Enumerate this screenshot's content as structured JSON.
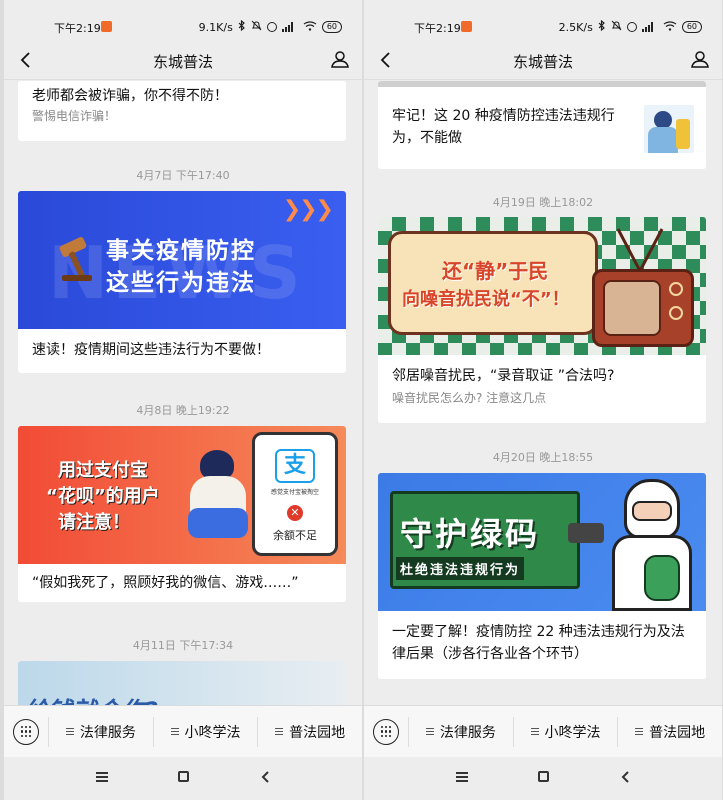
{
  "left": {
    "status": {
      "time": "下午2:19",
      "speed": "9.1K/s",
      "battery": "60"
    },
    "nav": {
      "title": "东城普法"
    },
    "card0": {
      "title": "老师都会被诈骗，你不得不防！",
      "sub": "警惕电信诈骗！"
    },
    "ts1": "4月7日 下午17:40",
    "card1": {
      "banner_line1": "事关疫情防控",
      "banner_line2": "这些行为违法",
      "banner_bg_word": "NEWS",
      "title": "速读！疫情期间这些违法行为不要做！"
    },
    "ts2": "4月8日 晚上19:22",
    "card2": {
      "banner_line1": "用过支付宝",
      "banner_line2": "“花呗”的用户",
      "banner_line3": "请注意！",
      "phone_logo": "支",
      "phone_small": "感觉支付宝被掏空",
      "phone_balance": "余额不足",
      "title": "“假如我死了，照顾好我的微信、游戏……”"
    },
    "ts3": "4月11日 下午17:34",
    "card3": {
      "banner_line1": "给钱就合作?"
    },
    "menu": [
      "法律服务",
      "小咚学法",
      "普法园地"
    ]
  },
  "right": {
    "status": {
      "time": "下午2:19",
      "speed": "2.5K/s",
      "battery": "60"
    },
    "nav": {
      "title": "东城普法"
    },
    "card0": {
      "title": "牢记！这 20 种疫情防控违法违规行为，不能做"
    },
    "ts1": "4月19日 晚上18:02",
    "card1": {
      "banner_line1": "还“静”于民",
      "banner_line2": "向噪音扰民说“不”！",
      "title": "邻居噪音扰民，“录音取证 ”合法吗?",
      "sub": "噪音扰民怎么办? 注意这几点"
    },
    "ts2": "4月20日 晚上18:55",
    "card2": {
      "banner_line1": "守护绿码",
      "banner_line2": "杜绝违法违规行为",
      "title": "一定要了解！疫情防控 22 种违法违规行为及法律后果（涉各行各业各个环节）"
    },
    "menu": [
      "法律服务",
      "小咚学法",
      "普法园地"
    ]
  },
  "colors": {
    "news_blue": "#2f56e6",
    "alipay_red": "#f0442c",
    "tv_green": "#2e8c5a",
    "green_code_blue": "#3d7ae6"
  }
}
